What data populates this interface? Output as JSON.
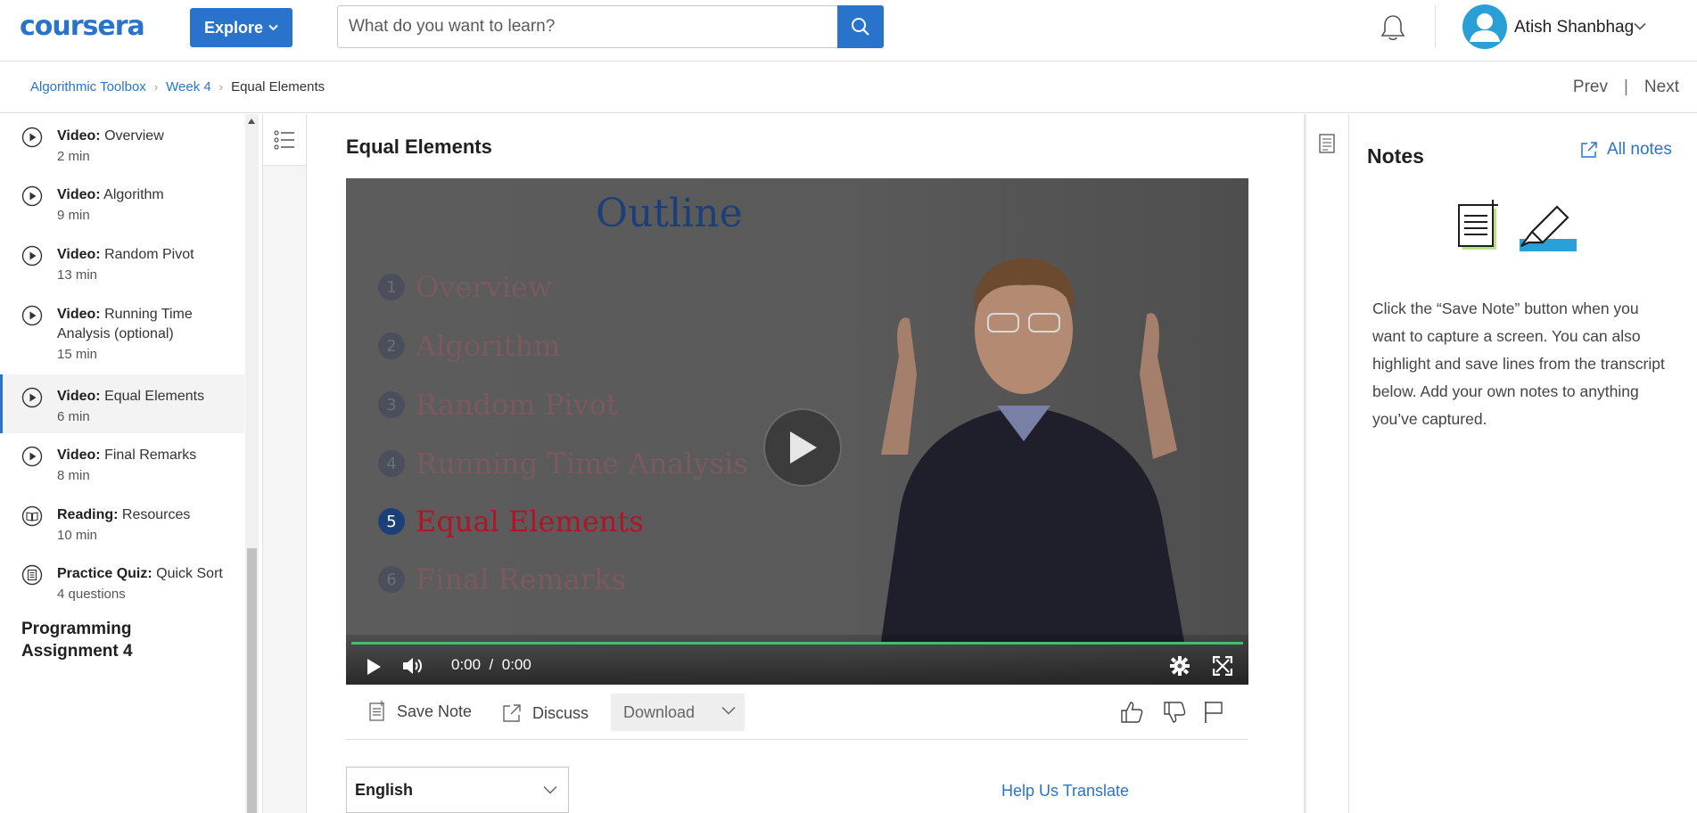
{
  "header": {
    "logo": "coursera",
    "explore_label": "Explore",
    "search": {
      "placeholder": "What do you want to learn?"
    },
    "user_name": "Atish Shanbhag"
  },
  "breadcrumb": {
    "items": [
      "Algorithmic Toolbox",
      "Week 4"
    ],
    "current": "Equal Elements",
    "prev": "Prev",
    "next": "Next"
  },
  "sidebar": {
    "items": [
      {
        "type": "Video:",
        "title": "Overview",
        "duration": "2 min",
        "icon": "play-circle-icon"
      },
      {
        "type": "Video:",
        "title": "Algorithm",
        "duration": "9 min",
        "icon": "play-circle-icon"
      },
      {
        "type": "Video:",
        "title": "Random Pivot",
        "duration": "13 min",
        "icon": "play-circle-icon"
      },
      {
        "type": "Video:",
        "title": "Running Time Analysis (optional)",
        "duration": "15 min",
        "icon": "play-circle-icon"
      },
      {
        "type": "Video:",
        "title": "Equal Elements",
        "duration": "6 min",
        "icon": "play-circle-icon",
        "active": true
      },
      {
        "type": "Video:",
        "title": "Final Remarks",
        "duration": "8 min",
        "icon": "play-circle-icon"
      },
      {
        "type": "Reading:",
        "title": "Resources",
        "duration": "10 min",
        "icon": "book-icon"
      },
      {
        "type": "Practice Quiz:",
        "title": "Quick Sort",
        "duration": "4 questions",
        "icon": "quiz-icon"
      }
    ],
    "section_title": "Programming Assignment 4"
  },
  "main": {
    "title": "Equal Elements",
    "video": {
      "slide_title": "Outline",
      "slide_items": [
        {
          "num": "1",
          "text": "Overview"
        },
        {
          "num": "2",
          "text": "Algorithm"
        },
        {
          "num": "3",
          "text": "Random Pivot"
        },
        {
          "num": "4",
          "text": "Running Time Analysis"
        },
        {
          "num": "5",
          "text": "Equal Elements",
          "highlight": true
        },
        {
          "num": "6",
          "text": "Final Remarks"
        }
      ],
      "current_time": "0:00",
      "time_sep": "/",
      "duration": "0:00"
    },
    "actions": {
      "save_note": "Save Note",
      "discuss": "Discuss",
      "download": "Download"
    },
    "language": "English",
    "help_translate": "Help Us Translate"
  },
  "notes": {
    "title": "Notes",
    "all_notes": "All notes",
    "description": "Click the “Save Note” button when you want to capture a screen. You can also highlight and save lines from the transcript below. Add your own notes to anything you’ve captured."
  },
  "colors": {
    "brand": "#2a73cc",
    "progress": "#3fbf6f",
    "slide_highlight": "#b01427"
  }
}
